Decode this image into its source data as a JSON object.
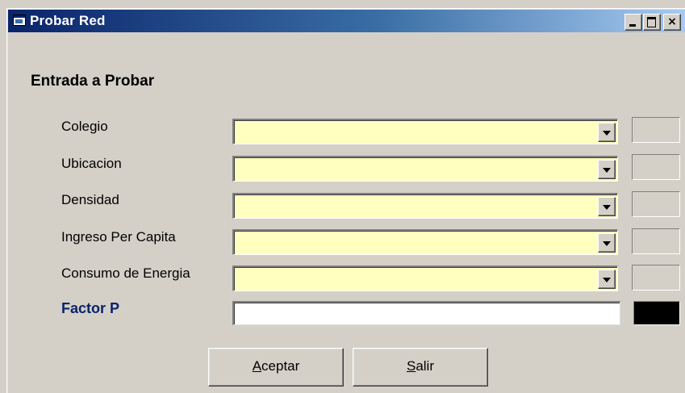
{
  "window": {
    "title": "Probar Red",
    "minimize": "",
    "maximize": "",
    "close": "×"
  },
  "section": {
    "title": "Entrada a Probar"
  },
  "inputs": [
    {
      "label": "Colegio",
      "value": ""
    },
    {
      "label": "Ubicacion",
      "value": ""
    },
    {
      "label": "Densidad",
      "value": ""
    },
    {
      "label": "Ingreso Per Capita",
      "value": ""
    },
    {
      "label": "Consumo de Energia",
      "value": ""
    }
  ],
  "factor": {
    "label": "Factor P",
    "value": ""
  },
  "buttons": {
    "aceptar_accel": "A",
    "aceptar_rest": "ceptar",
    "salir_accel": "S",
    "salir_rest": "alir"
  },
  "colors": {
    "combo_bg": "#ffffc0",
    "factor_label": "#0a246a",
    "factor_indicator": "#000000",
    "titlebar_start": "#0a246a",
    "titlebar_end": "#a6caf0"
  },
  "icons": [
    "window-app-icon",
    "minimize-icon",
    "maximize-icon",
    "close-icon",
    "dropdown-arrow-icon"
  ]
}
